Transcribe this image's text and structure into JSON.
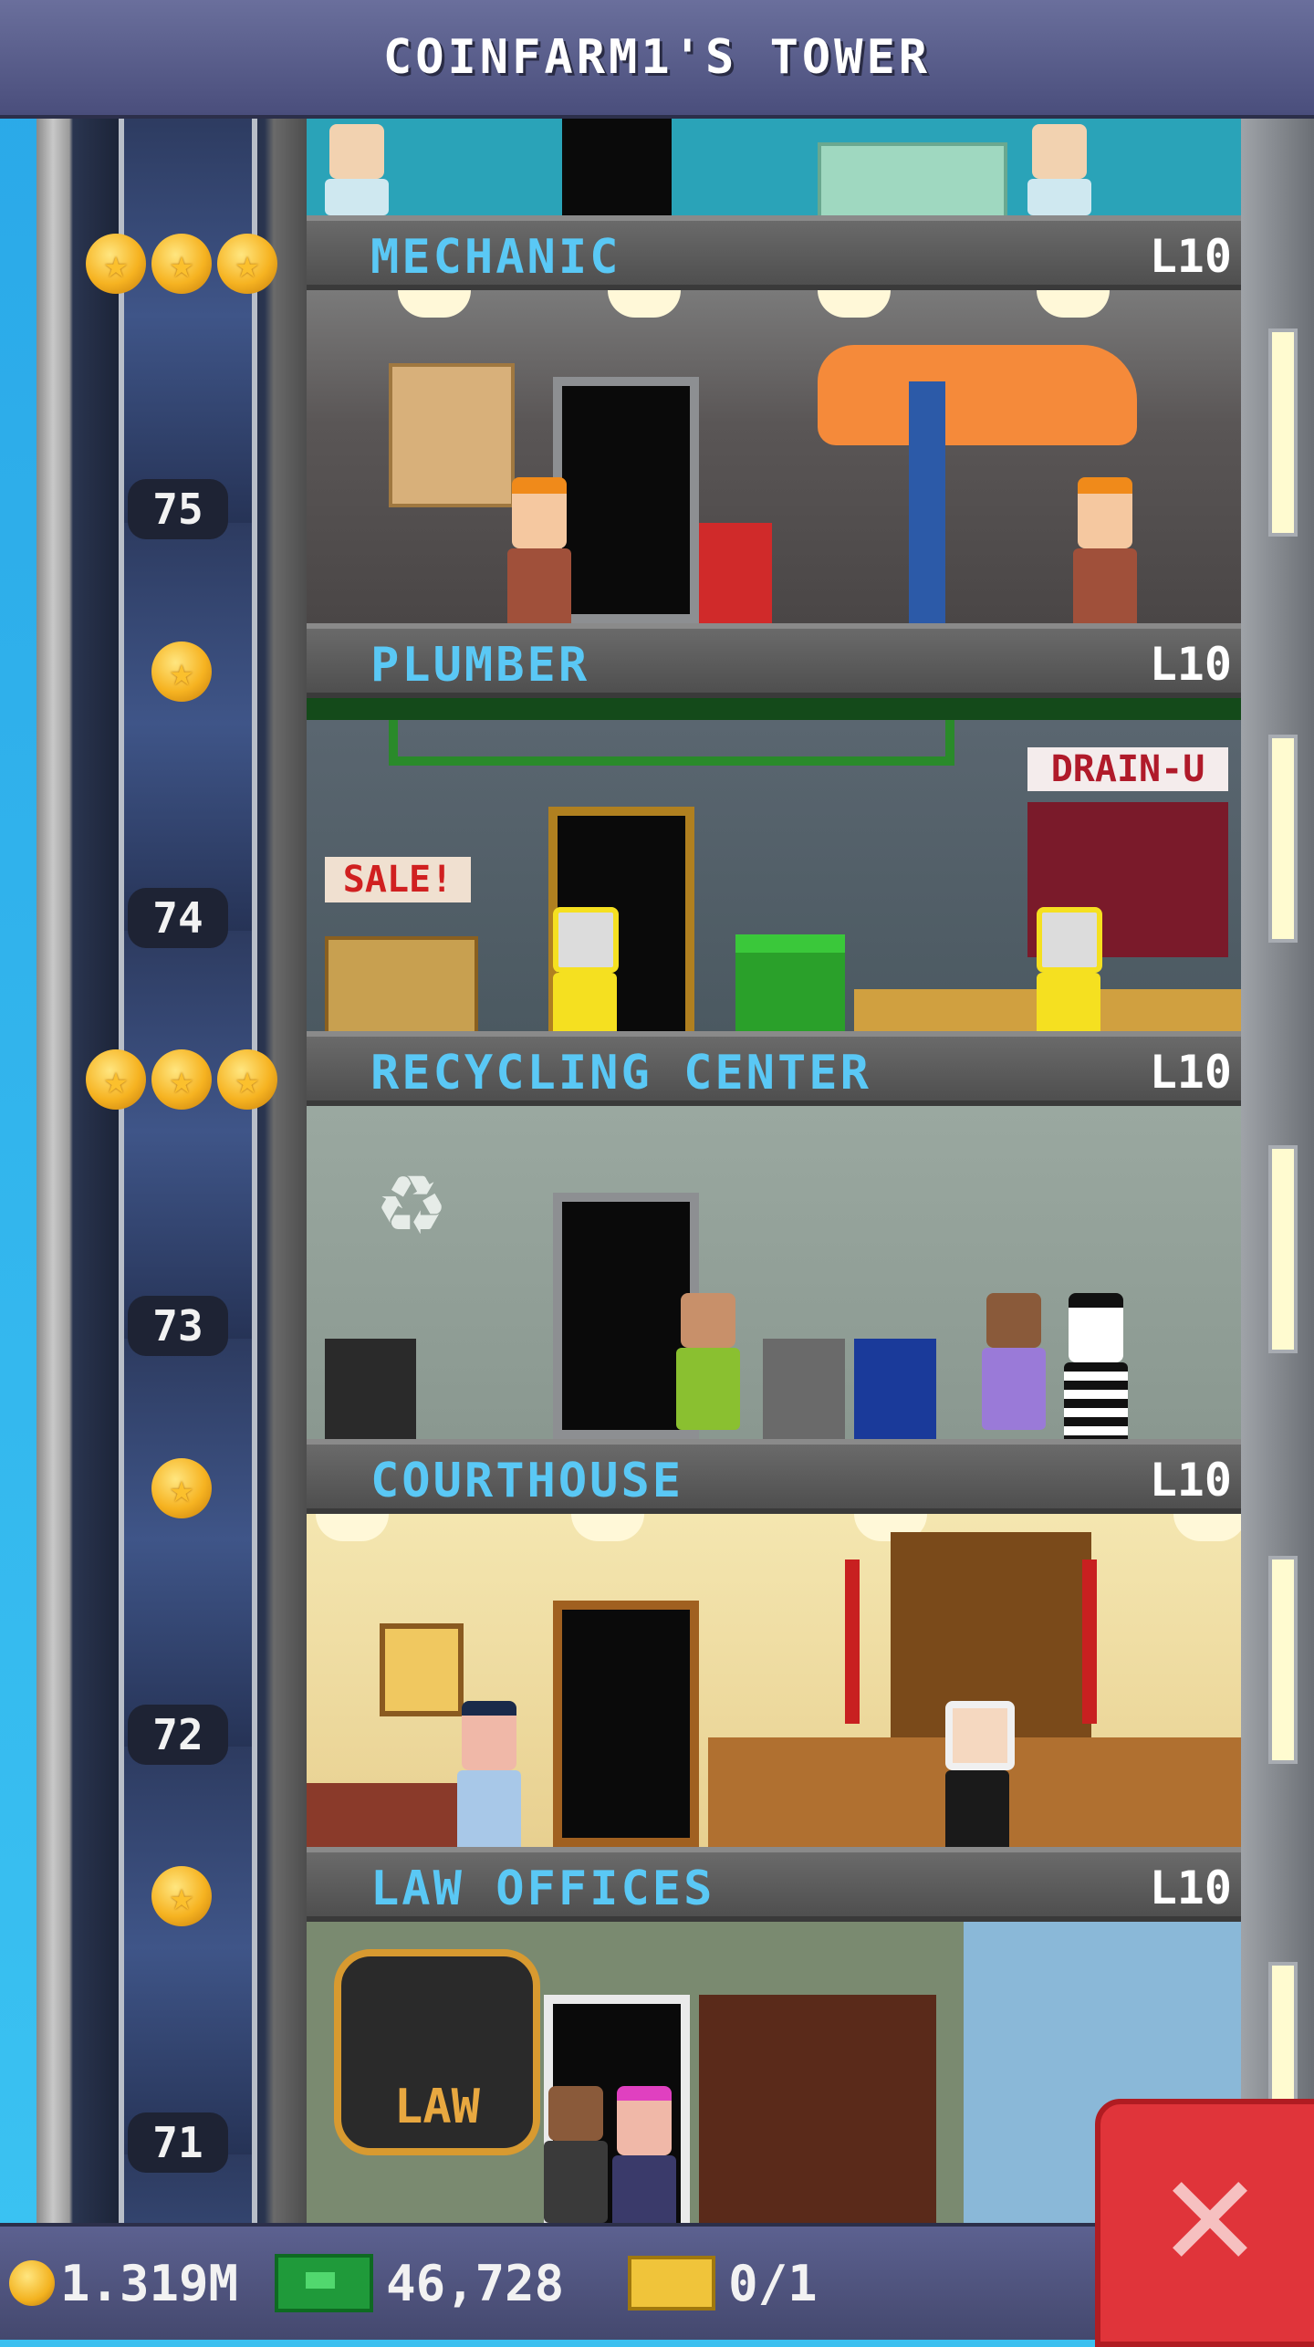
{
  "header": {
    "title": "COINFARM1'S TOWER"
  },
  "floors": [
    {
      "name": "MECHANIC",
      "level": "L10",
      "floor_number": "75",
      "stars": 3
    },
    {
      "name": "PLUMBER",
      "level": "L10",
      "floor_number": "74",
      "stars": 1
    },
    {
      "name": "RECYCLING CENTER",
      "level": "L10",
      "floor_number": "73",
      "stars": 3
    },
    {
      "name": "COURTHOUSE",
      "level": "L10",
      "floor_number": "72",
      "stars": 1
    },
    {
      "name": "LAW OFFICES",
      "level": "L10",
      "floor_number": "71",
      "stars": 1
    }
  ],
  "signs": {
    "sale": "SALE!",
    "drain": "DRAIN-U",
    "law": "LAW"
  },
  "footer": {
    "coins": "1.319M",
    "bux": "46,728",
    "tickets": "0/1"
  },
  "icons": {
    "coin": "coin-icon",
    "bux": "tower-bux-icon",
    "ticket": "ticket-icon",
    "close": "close-icon"
  },
  "colors": {
    "floor_name": "#5ac8f5",
    "header_bg": "#5a5f8c",
    "close_button": "#e0343a"
  }
}
